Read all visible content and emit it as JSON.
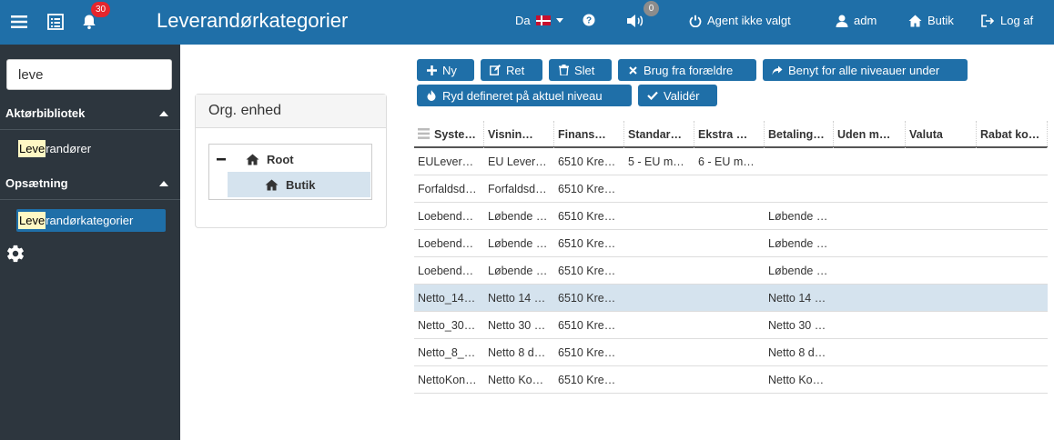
{
  "header": {
    "title": "Leverandørkategorier",
    "notifications_count": "30",
    "language": "Da",
    "sound_count": "0",
    "agent": "Agent ikke valgt",
    "user": "adm",
    "shop": "Butik",
    "logout": "Log af",
    "brand_color": "#1f6fa8"
  },
  "sidebar": {
    "search_value": "leve",
    "section1": "Aktørbibliotek",
    "section2": "Opsætning",
    "item1_hl": "Leve",
    "item1_rest": "randører",
    "item2_hl": "Leve",
    "item2_rest": "randørkategorier"
  },
  "org": {
    "title": "Org. enhed",
    "root": "Root",
    "child": "Butik"
  },
  "toolbar": {
    "new": "Ny",
    "edit": "Ret",
    "delete": "Slet",
    "use_parent": "Brug fra forældre",
    "apply_all": "Benyt for alle niveauer under",
    "clear_level": "Ryd defineret på aktuel niveau",
    "validate": "Validér"
  },
  "table": {
    "columns": [
      "Syste…",
      "Visnin…",
      "Finans…",
      "Standar…",
      "Ekstra …",
      "Betaling…",
      "Uden m…",
      "Valuta",
      "Rabat ko…"
    ],
    "rows": [
      [
        "EULever…",
        "EU Lever…",
        "6510 Kre…",
        "5 - EU m…",
        "6 - EU m…",
        "",
        "",
        "",
        ""
      ],
      [
        "Forfaldsd…",
        "Forfaldsd…",
        "6510 Kre…",
        "",
        "",
        "",
        "",
        "",
        ""
      ],
      [
        "Loebend…",
        "Løbende …",
        "6510 Kre…",
        "",
        "",
        "Løbende …",
        "",
        "",
        ""
      ],
      [
        "Loebend…",
        "Løbende …",
        "6510 Kre…",
        "",
        "",
        "Løbende …",
        "",
        "",
        ""
      ],
      [
        "Loebend…",
        "Løbende …",
        "6510 Kre…",
        "",
        "",
        "Løbende …",
        "",
        "",
        ""
      ],
      [
        "Netto_14…",
        "Netto 14 …",
        "6510 Kre…",
        "",
        "",
        "Netto 14 …",
        "",
        "",
        ""
      ],
      [
        "Netto_30…",
        "Netto 30 …",
        "6510 Kre…",
        "",
        "",
        "Netto 30 …",
        "",
        "",
        ""
      ],
      [
        "Netto_8_…",
        "Netto 8 d…",
        "6510 Kre…",
        "",
        "",
        "Netto 8 d…",
        "",
        "",
        ""
      ],
      [
        "NettoKon…",
        "Netto Ko…",
        "6510 Kre…",
        "",
        "",
        "Netto Ko…",
        "",
        "",
        ""
      ]
    ],
    "selected_row": 5
  }
}
